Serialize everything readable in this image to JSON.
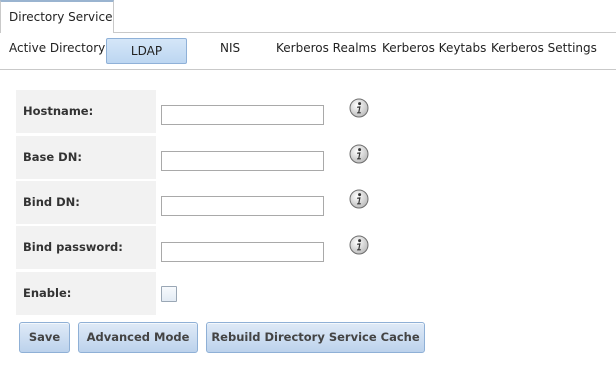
{
  "top_tab": {
    "label": "Directory Service"
  },
  "subtabs": [
    {
      "label": "Active Directory",
      "active": false
    },
    {
      "label": "LDAP",
      "active": true
    },
    {
      "label": "NIS",
      "active": false
    },
    {
      "label": "Kerberos Realms",
      "active": false
    },
    {
      "label": "Kerberos Keytabs",
      "active": false
    },
    {
      "label": "Kerberos Settings",
      "active": false
    }
  ],
  "form": {
    "hostname": {
      "label": "Hostname:",
      "value": ""
    },
    "base_dn": {
      "label": "Base DN:",
      "value": ""
    },
    "bind_dn": {
      "label": "Bind DN:",
      "value": ""
    },
    "bind_password": {
      "label": "Bind password:",
      "value": ""
    },
    "enable": {
      "label": "Enable:",
      "checked": false
    }
  },
  "icons": {
    "info": "info-icon"
  },
  "buttons": {
    "save": "Save",
    "advanced_mode": "Advanced Mode",
    "rebuild_cache": "Rebuild Directory Service Cache"
  }
}
